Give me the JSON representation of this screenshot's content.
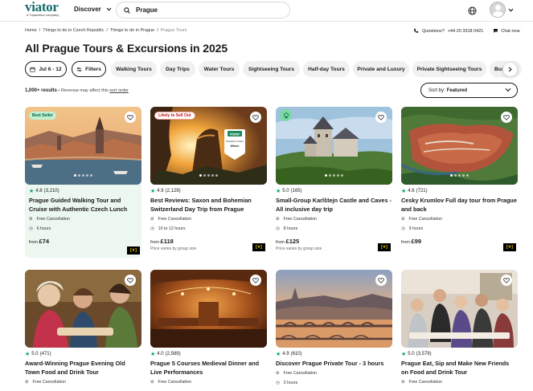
{
  "header": {
    "logo": "viator",
    "logo_sub": "a Tripadvisor company",
    "discover_label": "Discover",
    "search_value": "Prague"
  },
  "breadcrumb": [
    "Home",
    "/",
    "Things to do in Czech Republic",
    "/",
    "Things to do in Prague",
    "/",
    "Prague Tours"
  ],
  "help": {
    "questions": "Questions?",
    "phone": "+44 20 3318 0421",
    "chat": "Chat now"
  },
  "page_title": "All Prague Tours & Excursions in 2025",
  "filters": {
    "date": "Jul 6 - 12",
    "filters": "Filters",
    "chips": [
      "Walking Tours",
      "Day Trips",
      "Water Tours",
      "Sightseeing Tours",
      "Half-day Tours",
      "Private and Luxury",
      "Private Sightseeing Tours",
      "Bus"
    ]
  },
  "results": {
    "count": "1,000+ results",
    "note": "• Revenue may affect this",
    "link": "sort order"
  },
  "sort": {
    "label": "Sort by:",
    "value": "Featured"
  },
  "cards": [
    {
      "badge": "Best Seller",
      "rating": "4.8",
      "reviews": "(3,210)",
      "title": "Prague Guided Walking Tour and Cruise with Authentic Czech Lunch",
      "features": [
        "Free Cancellation",
        "6 hours"
      ],
      "price_prefix": "from",
      "price": "£74",
      "tag": "[#]"
    },
    {
      "badge": "Likely to Sell Out",
      "rating": "4.9",
      "reviews": "(2,129)",
      "title": "Best Reviews: Saxon and Bohemian Switzerland Day Trip from Prague",
      "features": [
        "Free Cancellation",
        "10 to 12 hours"
      ],
      "price_prefix": "from",
      "price": "£118",
      "price_note": "Price varies by group size",
      "tag": "[#]"
    },
    {
      "rating": "5.0",
      "reviews": "(165)",
      "title": "Small-Group Karlštejn Castle and Caves - All inclusive day trip",
      "features": [
        "Free Cancellation",
        "8 hours"
      ],
      "price_prefix": "from",
      "price": "£125",
      "price_note": "Price varies by group size",
      "tag": "[#]"
    },
    {
      "rating": "4.6",
      "reviews": "(721)",
      "title": "Cesky Krumlov Full day tour from Prague and back",
      "features": [
        "Free Cancellation",
        "9 hours"
      ],
      "price_prefix": "from",
      "price": "£99",
      "tag": "[#]"
    },
    {
      "rating": "5.0",
      "reviews": "(471)",
      "title": "Award-Winning Prague Evening Old Town Food and Drink Tour",
      "features": [
        "Free Cancellation"
      ]
    },
    {
      "rating": "4.0",
      "reviews": "(2,569)",
      "title": "Prague 5 Courses Medieval Dinner and Live Performances",
      "features": [
        "Free Cancellation"
      ]
    },
    {
      "rating": "4.9",
      "reviews": "(610)",
      "title": "Discover Prague Private Tour - 3 hours",
      "features": [
        "Free Cancellation",
        "3 hours"
      ]
    },
    {
      "rating": "5.0",
      "reviews": "(3,579)",
      "title": "Prague Eat, Sip and Make New Friends on Food and Drink Tour",
      "features": [
        "Free Cancellation"
      ]
    }
  ],
  "image_badge": {
    "brand": "viator",
    "line1": "Travellers' Choice",
    "line2": "Winner"
  },
  "colors": {
    "brand": "#186b6d",
    "star": "#00aa6c",
    "best_seller_bg": "#bff1d2",
    "sell_out": "#c4141b",
    "card_tint": "#ecf7f0"
  }
}
